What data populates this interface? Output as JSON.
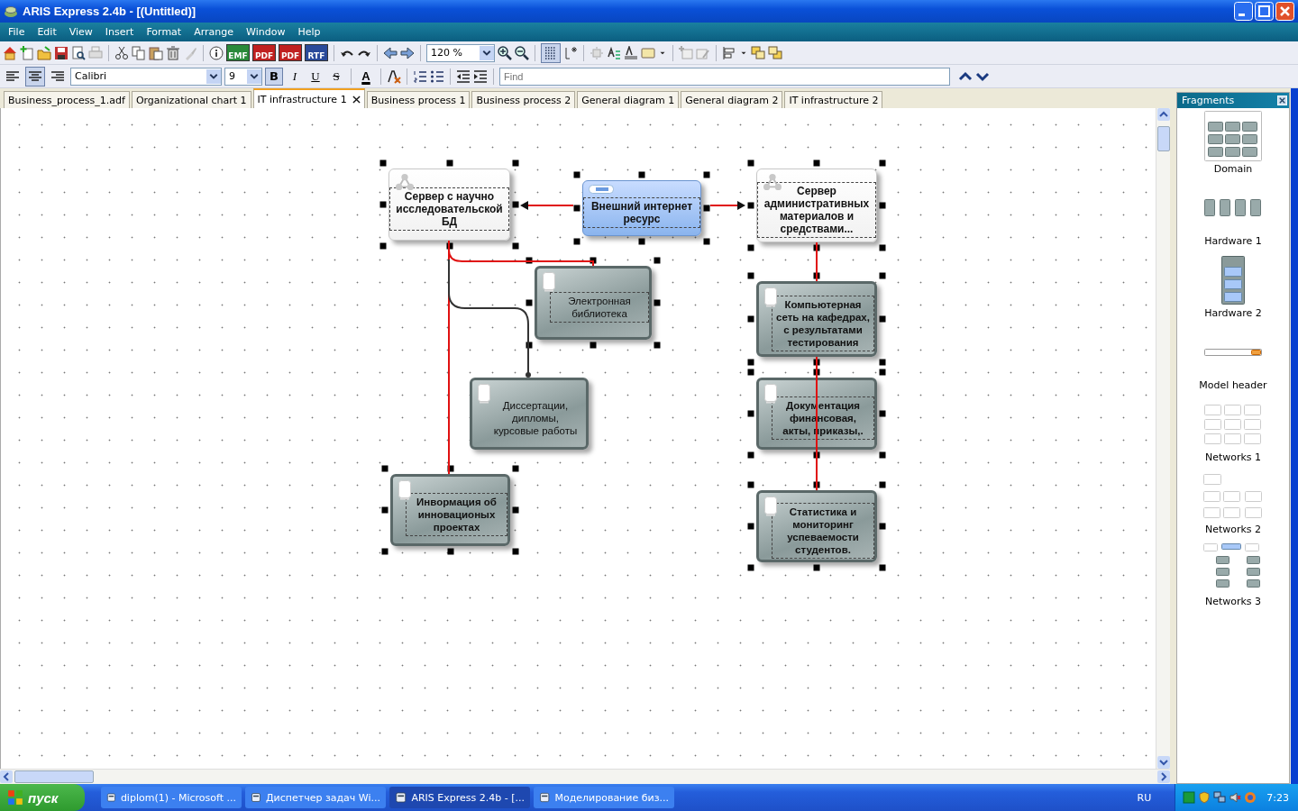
{
  "window": {
    "title": "ARIS Express 2.4b - [(Untitled)]"
  },
  "menu": [
    "File",
    "Edit",
    "View",
    "Insert",
    "Format",
    "Arrange",
    "Window",
    "Help"
  ],
  "toolbar": {
    "export_buttons": [
      {
        "label": "EMF"
      },
      {
        "label": "PDF"
      },
      {
        "label": "PDF"
      },
      {
        "label": "RTF"
      }
    ],
    "zoom": "120 %",
    "grid_on": true
  },
  "format_bar": {
    "align": [
      {
        "selected": false
      },
      {
        "selected": true
      },
      {
        "selected": false
      }
    ],
    "font": "Calibri",
    "size": "9",
    "style_buttons": [
      {
        "label": "B",
        "selected": true
      },
      {
        "label": "I",
        "selected": false
      },
      {
        "label": "U",
        "selected": false
      },
      {
        "label": "S",
        "selected": false
      }
    ],
    "font_color": "A",
    "find": {
      "placeholder": "Find"
    }
  },
  "tabs": [
    {
      "label": "Business_process_1.adf",
      "selected": false
    },
    {
      "label": "Organizational chart 1",
      "selected": false
    },
    {
      "label": "IT infrastructure 1",
      "selected": true
    },
    {
      "label": "Business process 1",
      "selected": false
    },
    {
      "label": "Business process 2",
      "selected": false
    },
    {
      "label": "General diagram 1",
      "selected": false
    },
    {
      "label": "General diagram 2",
      "selected": false
    },
    {
      "label": "IT infrastructure 2",
      "selected": false
    }
  ],
  "diagram": {
    "nodes": [
      {
        "kind": "server",
        "label": "Сервер с научно исследовательской БД",
        "bold": true,
        "selected": true
      },
      {
        "kind": "internet",
        "label": "Внешний интернет ресурс",
        "bold": true,
        "selected": true
      },
      {
        "kind": "server",
        "label": "Сервер административных материалов и средствами...",
        "bold": true,
        "selected": true
      },
      {
        "kind": "storage",
        "label": "Электронная библиотека",
        "bold": false,
        "selected": true
      },
      {
        "kind": "storage",
        "label": "Компьютерная сеть на кафедрах, с результатами тестирования",
        "bold": true,
        "selected": true
      },
      {
        "kind": "storage",
        "label": "Диссертации, дипломы, курсовые работы",
        "bold": false,
        "selected": false
      },
      {
        "kind": "storage",
        "label": "Документация финансовая, акты, приказы,.",
        "bold": true,
        "selected": true
      },
      {
        "kind": "storage",
        "label": "Инвормация об инновационых проектах",
        "bold": true,
        "selected": true
      },
      {
        "kind": "storage",
        "label": "Статистика и мониторинг успеваемости студентов.",
        "bold": true,
        "selected": true
      }
    ],
    "connections": [
      {
        "selected": true,
        "arrow": true
      },
      {
        "selected": true,
        "arrow": true
      },
      {
        "selected": true
      },
      {
        "selected": true
      },
      {
        "selected": false
      },
      {
        "selected": true
      },
      {
        "selected": true
      }
    ]
  },
  "fragments": {
    "title": "Fragments",
    "items": [
      "Domain",
      "Hardware 1",
      "Hardware 2",
      "Model header",
      "Networks 1",
      "Networks 2",
      "Networks 3"
    ]
  },
  "taskbar": {
    "start": "пуск",
    "tasks": [
      {
        "label": "diplom(1) - Microsoft ...",
        "selected": false
      },
      {
        "label": "Диспетчер задач Wi...",
        "selected": false
      },
      {
        "label": "ARIS Express 2.4b - [...",
        "selected": true
      },
      {
        "label": "Моделирование биз...",
        "selected": false
      }
    ],
    "language": "RU",
    "clock": "7:23"
  }
}
